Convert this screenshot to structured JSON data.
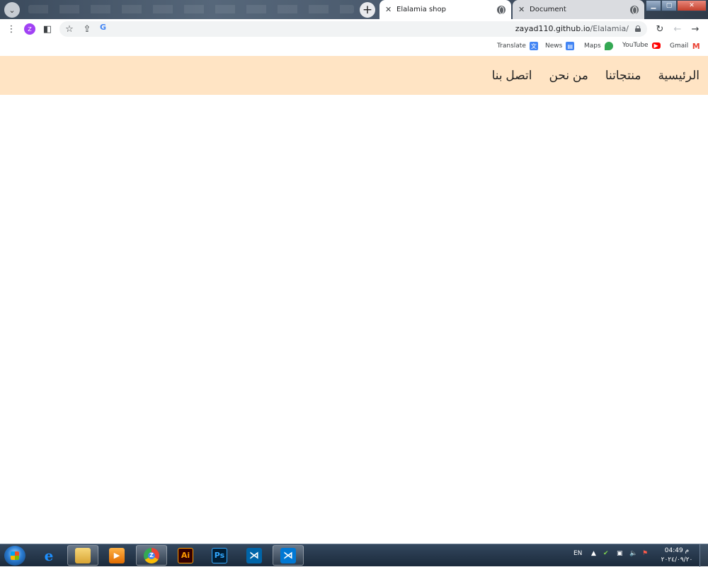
{
  "browser": {
    "tabs": [
      {
        "title": "Elalamia shop",
        "active": true
      },
      {
        "title": "Document",
        "active": false
      }
    ],
    "profile_initial": "Z",
    "url_host": "zayad110.github.io",
    "url_path": "/Elalamia/"
  },
  "bookmarks": [
    {
      "label": "Translate",
      "icon": "translate-icon",
      "color": "#4285f4"
    },
    {
      "label": "News",
      "icon": "news-icon",
      "color": "#4285f4"
    },
    {
      "label": "Maps",
      "icon": "maps-icon",
      "color": "#34a853"
    },
    {
      "label": "YouTube",
      "icon": "youtube-icon",
      "color": "#ff0000"
    },
    {
      "label": "Gmail",
      "icon": "gmail-icon",
      "color": "#ea4335"
    }
  ],
  "page": {
    "navbar_background": "#ffe4c4",
    "nav_items": [
      "الرئيسية",
      "منتجاتنا",
      "من نحن",
      "اتصل بنا"
    ]
  },
  "taskbar": {
    "apps": [
      {
        "name": "internet-explorer"
      },
      {
        "name": "file-explorer"
      },
      {
        "name": "media-player"
      },
      {
        "name": "chrome",
        "label": "Z"
      },
      {
        "name": "illustrator",
        "label": "Ai"
      },
      {
        "name": "photoshop",
        "label": "Ps"
      },
      {
        "name": "vscode"
      },
      {
        "name": "vscode"
      }
    ],
    "language": "EN",
    "clock_time": "04:49 م",
    "clock_date": "٢٠٢٤/٠٩/٢٠"
  }
}
